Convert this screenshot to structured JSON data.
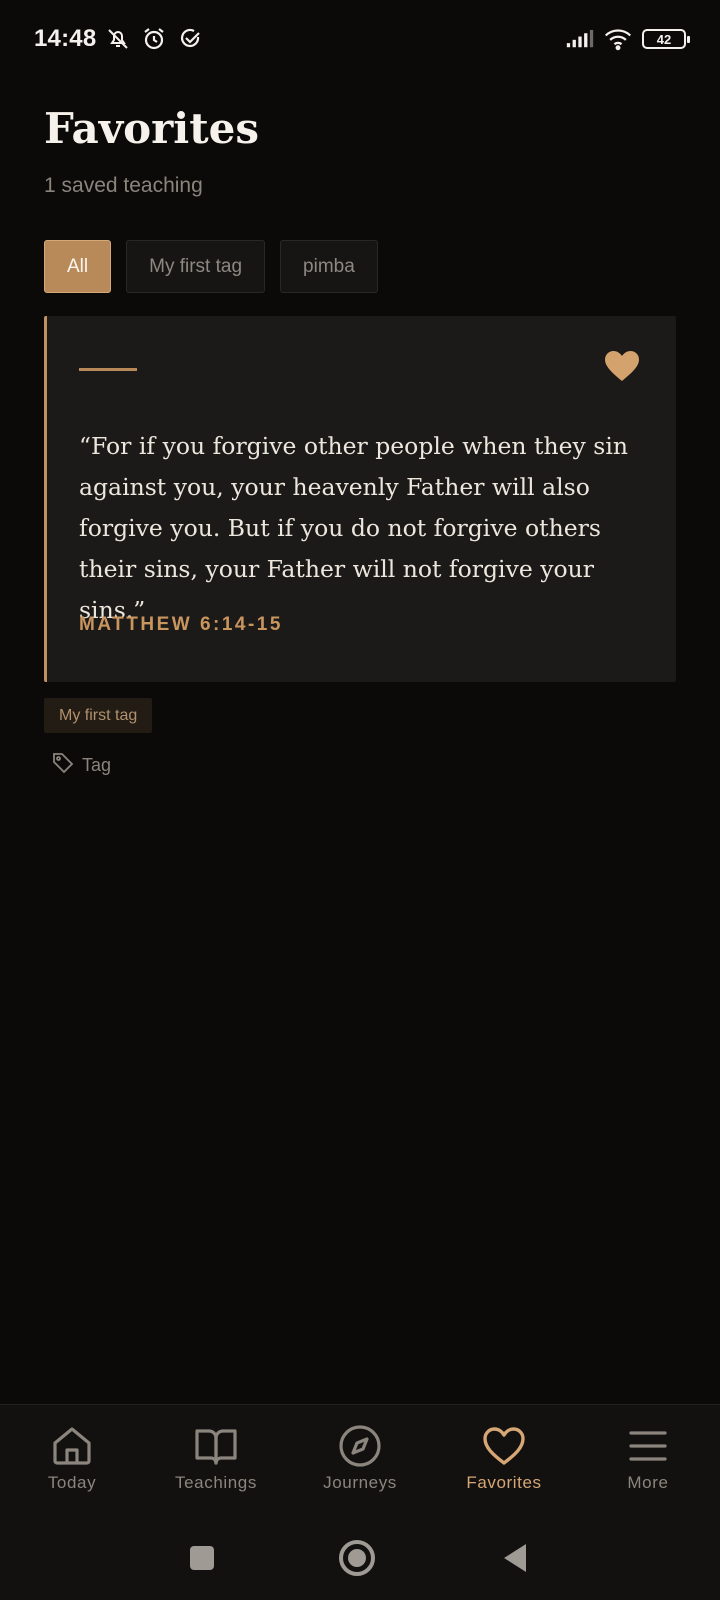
{
  "status_bar": {
    "time": "14:48",
    "battery": "42",
    "icons": [
      "mute-icon",
      "alarm-icon",
      "check-circle-icon",
      "signal-icon",
      "wifi-icon",
      "battery-icon"
    ]
  },
  "header": {
    "title": "Favorites",
    "subtitle": "1 saved teaching"
  },
  "filters": {
    "chips": [
      {
        "label": "All",
        "active": true
      },
      {
        "label": "My first tag",
        "active": false
      },
      {
        "label": "pimba",
        "active": false
      }
    ]
  },
  "card": {
    "quote": "“For if you forgive other people when they sin against you, your heavenly Father will also forgive you. But if you do not forgive others their sins, your Father will not forgive your sins.”",
    "reference": "MATTHEW 6:14-15",
    "favorited": true,
    "tags": [
      "My first tag"
    ],
    "add_tag_label": "Tag"
  },
  "bottom_nav": {
    "items": [
      {
        "label": "Today",
        "icon": "home-icon",
        "active": false
      },
      {
        "label": "Teachings",
        "icon": "book-icon",
        "active": false
      },
      {
        "label": "Journeys",
        "icon": "compass-icon",
        "active": false
      },
      {
        "label": "Favorites",
        "icon": "heart-icon",
        "active": true
      },
      {
        "label": "More",
        "icon": "menu-icon",
        "active": false
      }
    ]
  },
  "colors": {
    "background": "#0b0a09",
    "accent": "#c8955e",
    "card": "#1c1a18",
    "muted_text": "#8a847c"
  }
}
